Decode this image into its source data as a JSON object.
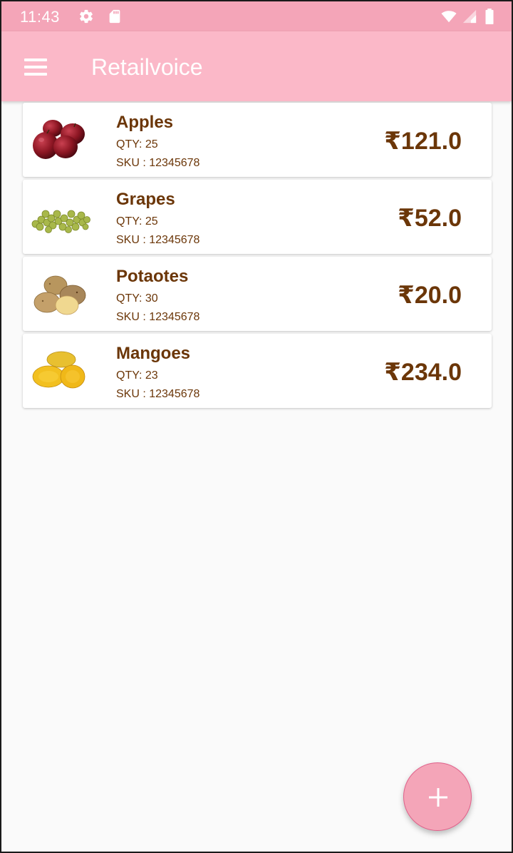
{
  "status_bar": {
    "time": "11:43",
    "icons": [
      "gear-icon",
      "sd-card-icon",
      "wifi-icon",
      "signal-icon",
      "battery-icon"
    ]
  },
  "app_bar": {
    "title": "Retailvoice",
    "menu_icon": "menu-icon"
  },
  "colors": {
    "status_bar": "#f4a5b8",
    "app_bar": "#fbb8c8",
    "text": "#6b3608",
    "fab": "#f4a5b8"
  },
  "products": [
    {
      "name": "Apples",
      "qty_label": "QTY: 25",
      "sku_label": "SKU : 12345678",
      "price": "₹121.0",
      "image": "apples"
    },
    {
      "name": "Grapes",
      "qty_label": "QTY: 25",
      "sku_label": "SKU : 12345678",
      "price": "₹52.0",
      "image": "grapes"
    },
    {
      "name": "Potaotes",
      "qty_label": "QTY: 30",
      "sku_label": "SKU : 12345678",
      "price": "₹20.0",
      "image": "potatoes"
    },
    {
      "name": "Mangoes",
      "qty_label": "QTY: 23",
      "sku_label": "SKU : 12345678",
      "price": "₹234.0",
      "image": "mangoes"
    }
  ],
  "fab": {
    "icon": "plus-icon"
  }
}
